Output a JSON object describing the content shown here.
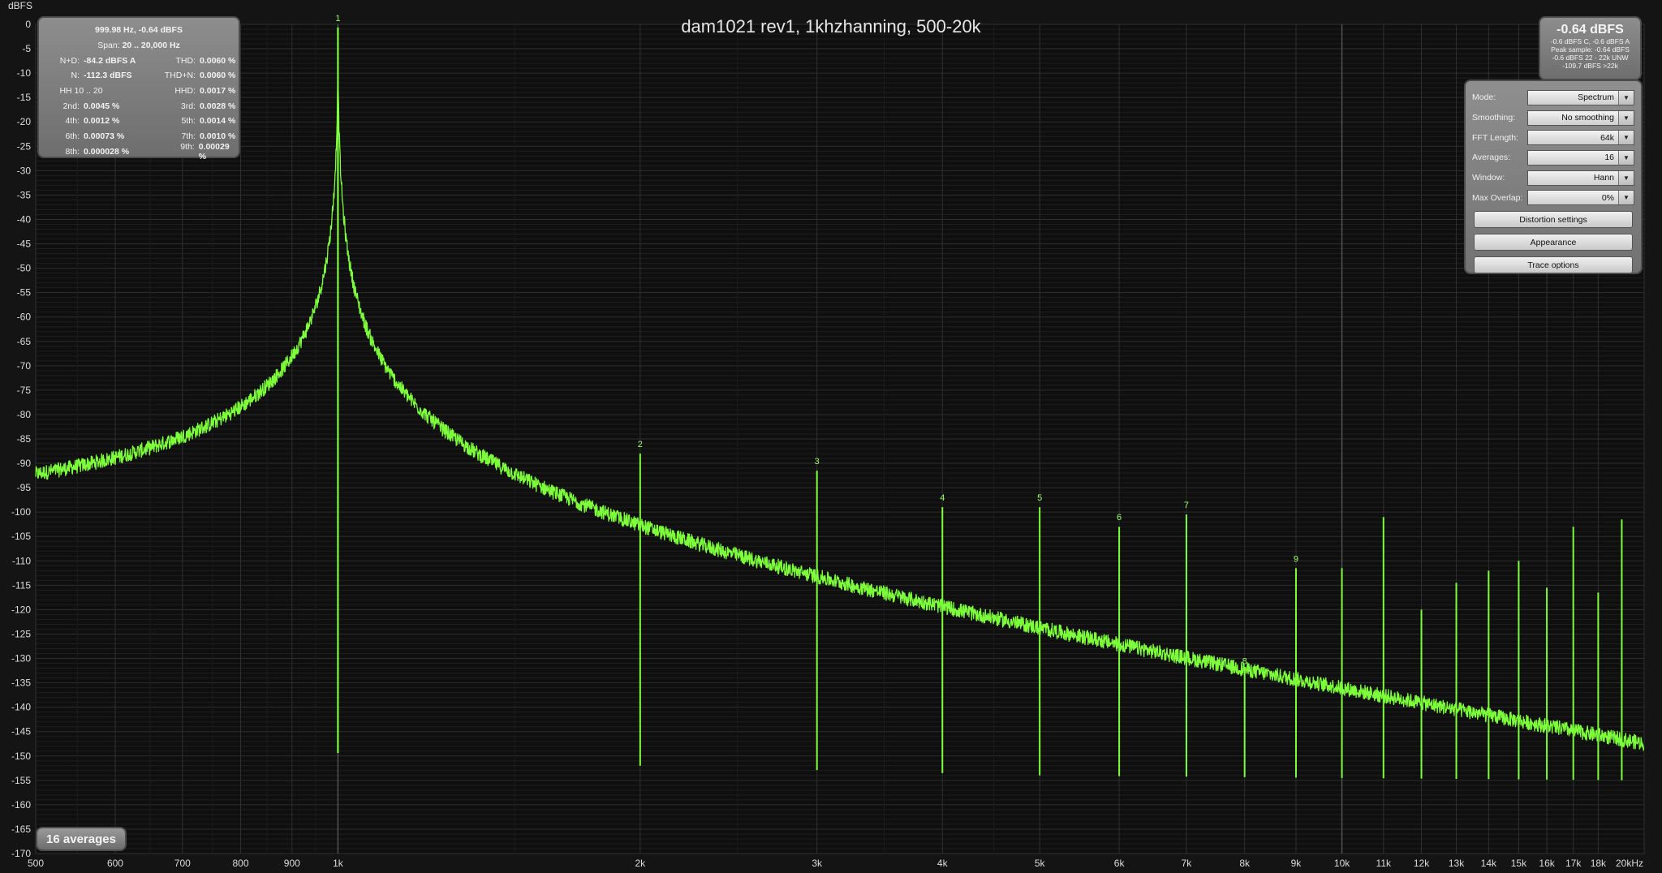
{
  "chart_data": {
    "type": "line",
    "title": "dam1021 rev1, 1khzhanning, 500-20k",
    "ylabel": "dBFS",
    "x_scale": "log",
    "xlim": [
      500,
      20000
    ],
    "ylim": [
      -170,
      0
    ],
    "x_ticks": [
      500,
      600,
      700,
      800,
      900,
      1000,
      2000,
      3000,
      4000,
      5000,
      6000,
      7000,
      8000,
      9000,
      10000,
      11000,
      12000,
      13000,
      14000,
      15000,
      16000,
      17000,
      18000,
      20000
    ],
    "x_tick_labels": [
      "500",
      "600",
      "700",
      "800",
      "900",
      "1k",
      "2k",
      "3k",
      "4k",
      "5k",
      "6k",
      "7k",
      "8k",
      "9k",
      "10k",
      "11k",
      "12k",
      "13k",
      "14k",
      "15k",
      "16k",
      "17k",
      "18k",
      "20kHz"
    ],
    "y_ticks": [
      0,
      -5,
      -10,
      -15,
      -20,
      -25,
      -30,
      -35,
      -40,
      -45,
      -50,
      -55,
      -60,
      -65,
      -70,
      -75,
      -80,
      -85,
      -90,
      -95,
      -100,
      -105,
      -110,
      -115,
      -120,
      -125,
      -130,
      -135,
      -140,
      -145,
      -150,
      -155,
      -160,
      -165,
      -170
    ],
    "y_tick_labels": [
      "0",
      "-5",
      "-10",
      "-15",
      "-20",
      "-25",
      "-30",
      "-35",
      "-40",
      "-45",
      "-50",
      "-55",
      "-60",
      "-65",
      "-70",
      "-75",
      "-80",
      "-85",
      "-90",
      "-95",
      "-100",
      "-105",
      "-110",
      "-115",
      "-120",
      "-125",
      "-130",
      "-135",
      "-140",
      "-145",
      "-150",
      "-155",
      "-160",
      "-165",
      "-170"
    ],
    "grid": true,
    "series": [
      {
        "color": "#7dff3c",
        "noise_floor": [
          [
            500,
            -152
          ],
          [
            900,
            -151
          ],
          [
            2000,
            -154
          ],
          [
            5000,
            -156
          ],
          [
            20000,
            -157
          ]
        ],
        "peaks": [
          {
            "freq": 1000,
            "level": -0.64,
            "label": "1"
          },
          {
            "freq": 2000,
            "level": -88,
            "label": "2"
          },
          {
            "freq": 3000,
            "level": -91.5,
            "label": "3"
          },
          {
            "freq": 4000,
            "level": -99,
            "label": "4"
          },
          {
            "freq": 5000,
            "level": -99,
            "label": "5"
          },
          {
            "freq": 6000,
            "level": -103,
            "label": "6"
          },
          {
            "freq": 7000,
            "level": -100.5,
            "label": "7"
          },
          {
            "freq": 8000,
            "level": -132.5,
            "label": "8"
          },
          {
            "freq": 9000,
            "level": -111.5,
            "label": "9"
          },
          {
            "freq": 10000,
            "level": -111.5,
            "label": ""
          },
          {
            "freq": 11000,
            "level": -101,
            "label": ""
          },
          {
            "freq": 12000,
            "level": -120,
            "label": ""
          },
          {
            "freq": 13000,
            "level": -114.5,
            "label": ""
          },
          {
            "freq": 14000,
            "level": -112,
            "label": ""
          },
          {
            "freq": 15000,
            "level": -110,
            "label": ""
          },
          {
            "freq": 16000,
            "level": -115.5,
            "label": ""
          },
          {
            "freq": 17000,
            "level": -103,
            "label": ""
          },
          {
            "freq": 18000,
            "level": -116.5,
            "label": ""
          },
          {
            "freq": 19000,
            "level": -101.5,
            "label": ""
          }
        ]
      }
    ]
  },
  "distortion_panel": {
    "header": "999.98 Hz, -0.64 dBFS",
    "span_label": "Span:",
    "span_value": "20 .. 20,000 Hz",
    "nd_label": "N+D:",
    "nd_value": "-84.2 dBFS A",
    "thd_label": "THD:",
    "thd_value": "0.0060 %",
    "n_label": "N:",
    "n_value": "-112.3 dBFS",
    "thdn_label": "THD+N:",
    "thdn_value": "0.0060 %",
    "hh_label": "HH 10 .. 20",
    "hhd_label": "HHD:",
    "hhd_value": "0.0017 %",
    "h2_label": "2nd:",
    "h2_value": "0.0045 %",
    "h3_label": "3rd:",
    "h3_value": "0.0028 %",
    "h4_label": "4th:",
    "h4_value": "0.0012 %",
    "h5_label": "5th:",
    "h5_value": "0.0014 %",
    "h6_label": "6th:",
    "h6_value": "0.00073 %",
    "h7_label": "7th:",
    "h7_value": "0.0010 %",
    "h8_label": "8th:",
    "h8_value": "0.000028 %",
    "h9_label": "9th:",
    "h9_value": "0.00029 %"
  },
  "peak_panel": {
    "main": "-0.64 dBFS",
    "line1": "-0.6 dBFS C, -0.6 dBFS A",
    "line2": "Peak sample: -0.64 dBFS",
    "line3": "-0.6 dBFS 22 - 22k UNW",
    "line4": "-109.7 dBFS >22k"
  },
  "settings_panel": {
    "mode_label": "Mode:",
    "mode_value": "Spectrum",
    "smoothing_label": "Smoothing:",
    "smoothing_value": "No  smoothing",
    "fft_label": "FFT Length:",
    "fft_value": "64k",
    "averages_label": "Averages:",
    "averages_value": "16",
    "window_label": "Window:",
    "window_value": "Hann",
    "overlap_label": "Max Overlap:",
    "overlap_value": "0%",
    "distortion_btn": "Distortion settings",
    "appearance_btn": "Appearance",
    "trace_btn": "Trace options"
  },
  "averages_badge": "16 averages",
  "icons": {
    "dropdown": "chevron-down-icon"
  }
}
